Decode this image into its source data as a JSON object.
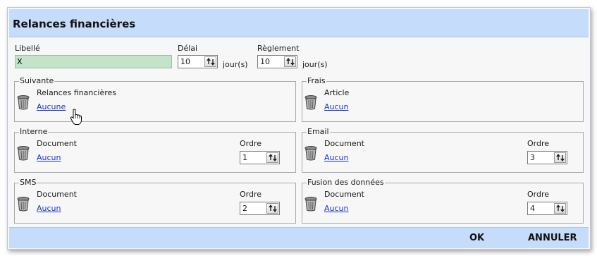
{
  "dialog": {
    "title": "Relances financières"
  },
  "fields": {
    "libelle": {
      "label": "Libellé",
      "value": "X"
    },
    "delai": {
      "label": "Délai",
      "value": "10",
      "unit": "jour(s)"
    },
    "reglement": {
      "label": "Règlement",
      "value": "10",
      "unit": "jour(s)"
    }
  },
  "groups": {
    "suivante": {
      "title": "Suivante",
      "line1": "Relances financières",
      "link": "Aucune"
    },
    "frais": {
      "title": "Frais",
      "line1": "Article",
      "link": "Aucun"
    },
    "interne": {
      "title": "Interne",
      "line1": "Document",
      "link": "Aucun",
      "ordre_label": "Ordre",
      "ordre_value": "1"
    },
    "email": {
      "title": "Email",
      "line1": "Document",
      "link": "Aucun",
      "ordre_label": "Ordre",
      "ordre_value": "3"
    },
    "sms": {
      "title": "SMS",
      "line1": "Document",
      "link": "Aucun",
      "ordre_label": "Ordre",
      "ordre_value": "2"
    },
    "fusion": {
      "title": "Fusion des données",
      "line1": "Document",
      "link": "Aucun",
      "ordre_label": "Ordre",
      "ordre_value": "4"
    }
  },
  "footer": {
    "ok_label": "OK",
    "cancel_label": "ANNULER"
  },
  "icons": {
    "delete": "trash-icon",
    "spinner": "spin-arrows-icon",
    "pointer": "hand-cursor-icon"
  },
  "colors": {
    "titlebar": "#c5dcfa",
    "input_active": "#c4e3c9",
    "link": "#1b36c7"
  }
}
